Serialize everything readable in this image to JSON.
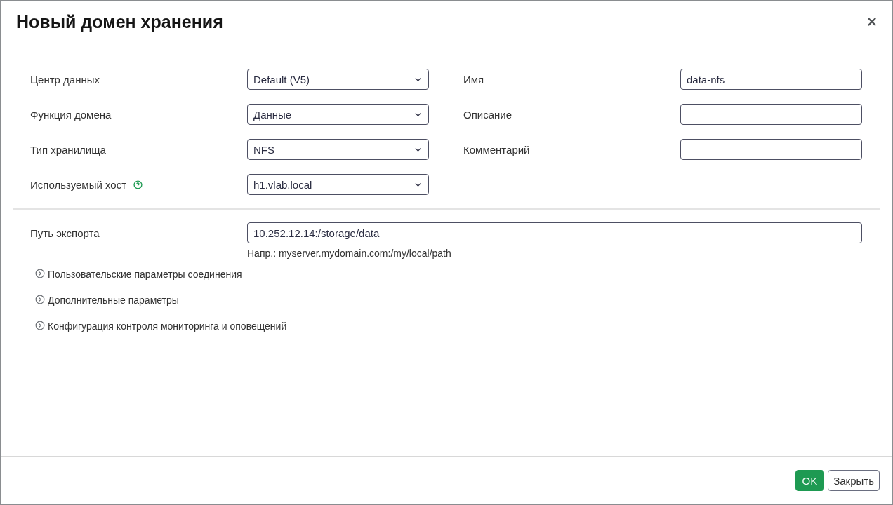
{
  "dialog": {
    "title": "Новый домен хранения"
  },
  "fields_left": [
    {
      "label": "Центр данных",
      "kind": "select",
      "value": "Default (V5)"
    },
    {
      "label": "Функция домена",
      "kind": "select",
      "value": "Данные"
    },
    {
      "label": "Тип хранилища",
      "kind": "select",
      "value": "NFS"
    },
    {
      "label": "Используемый хост",
      "kind": "select",
      "value": "h1.vlab.local",
      "help": true
    }
  ],
  "fields_right": [
    {
      "label": "Имя",
      "kind": "text",
      "value": "data-nfs"
    },
    {
      "label": "Описание",
      "kind": "text"
    },
    {
      "label": "Комментарий",
      "kind": "text"
    }
  ],
  "export_path": {
    "label": "Путь экспорта",
    "kind": "text",
    "value": "10.252.12.14:/storage/data",
    "hint": "Напр.: myserver.mydomain.com:/my/local/path"
  },
  "sections": [
    {
      "label": "Пользовательские параметры соединения",
      "expanded": false
    },
    {
      "label": "Дополнительные параметры",
      "expanded": false
    },
    {
      "label": "Конфигурация контроля мониторинга и оповещений",
      "expanded": false
    }
  ],
  "buttons": [
    {
      "label": "OK",
      "kind": "primary"
    },
    {
      "label": "Закрыть",
      "kind": "secondary"
    }
  ]
}
